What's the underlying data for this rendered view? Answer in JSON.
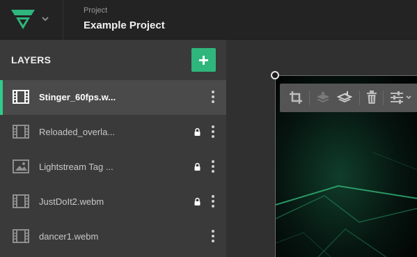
{
  "header": {
    "project_caption": "Project",
    "project_name": "Example Project"
  },
  "sidebar": {
    "title": "LAYERS",
    "add_label": "+",
    "layers": [
      {
        "name": "Stinger_60fps.w...",
        "type": "video",
        "locked": false,
        "selected": true
      },
      {
        "name": "Reloaded_overla...",
        "type": "video",
        "locked": true,
        "selected": false
      },
      {
        "name": "Lightstream Tag ...",
        "type": "image",
        "locked": true,
        "selected": false
      },
      {
        "name": "JustDoIt2.webm",
        "type": "video",
        "locked": true,
        "selected": false
      },
      {
        "name": "dancer1.webm",
        "type": "video",
        "locked": false,
        "selected": false
      }
    ]
  },
  "toolbar": {
    "tools": [
      "crop-icon",
      "bring-forward-icon",
      "send-backward-icon",
      "trash-icon",
      "adjust-sliders-icon"
    ]
  },
  "colors": {
    "accent": "#2eb67d",
    "selected_bar": "#2ecc8a",
    "topbar": "#232323",
    "sidebar": "#3a3a3a",
    "selected_row": "#4a4a4a"
  }
}
